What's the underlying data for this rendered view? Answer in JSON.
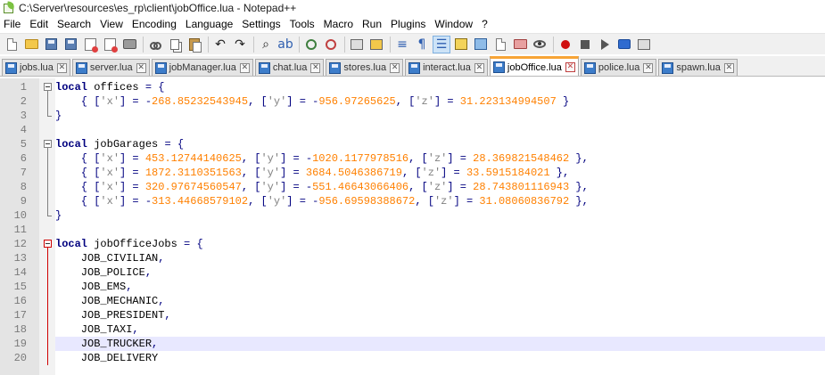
{
  "window": {
    "title": "C:\\Server\\resources\\es_rp\\client\\jobOffice.lua - Notepad++"
  },
  "menu": [
    "File",
    "Edit",
    "Search",
    "View",
    "Encoding",
    "Language",
    "Settings",
    "Tools",
    "Macro",
    "Run",
    "Plugins",
    "Window",
    "?"
  ],
  "toolbar": {
    "icons": [
      "new-file-icon",
      "open-file-icon",
      "save-icon",
      "save-all-icon",
      "close-icon",
      "close-all-icon",
      "print-icon",
      "cut-icon",
      "copy-icon",
      "paste-icon",
      "undo-icon",
      "redo-icon",
      "find-icon",
      "replace-icon",
      "zoom-in-icon",
      "zoom-out-icon",
      "sync-vertical-icon",
      "sync-horizontal-icon",
      "word-wrap-icon",
      "show-all-chars-icon",
      "indent-guide-icon",
      "user-language-icon",
      "doc-map-icon",
      "function-list-icon",
      "folder-workspace-icon",
      "monitoring-icon",
      "record-macro-icon",
      "stop-macro-icon",
      "play-macro-icon",
      "run-macro-multiple-icon",
      "save-macro-icon"
    ],
    "active_icon": "indent-guide-icon"
  },
  "tabs": [
    {
      "label": "jobs.lua",
      "active": false
    },
    {
      "label": "server.lua",
      "active": false
    },
    {
      "label": "jobManager.lua",
      "active": false
    },
    {
      "label": "chat.lua",
      "active": false
    },
    {
      "label": "stores.lua",
      "active": false
    },
    {
      "label": "interact.lua",
      "active": false
    },
    {
      "label": "jobOffice.lua",
      "active": true
    },
    {
      "label": "police.lua",
      "active": false
    },
    {
      "label": "spawn.lua",
      "active": false
    }
  ],
  "editor": {
    "current_line": 19,
    "lines": [
      {
        "n": "1",
        "fold": "open",
        "tokens": [
          [
            "kw",
            "local"
          ],
          [
            "id",
            " offices "
          ],
          [
            "op",
            "= {"
          ]
        ]
      },
      {
        "n": "2",
        "fold": "line",
        "tokens": [
          [
            "op",
            "    { ["
          ],
          [
            "str",
            "'x'"
          ],
          [
            "op",
            "] = -"
          ],
          [
            "num",
            "268.85232543945"
          ],
          [
            "op",
            ", ["
          ],
          [
            "str",
            "'y'"
          ],
          [
            "op",
            "] = -"
          ],
          [
            "num",
            "956.97265625"
          ],
          [
            "op",
            ", ["
          ],
          [
            "str",
            "'z'"
          ],
          [
            "op",
            "] = "
          ],
          [
            "num",
            "31.223134994507"
          ],
          [
            "op",
            " }"
          ]
        ]
      },
      {
        "n": "3",
        "fold": "end",
        "tokens": [
          [
            "op",
            "}"
          ]
        ]
      },
      {
        "n": "4",
        "fold": "none",
        "tokens": []
      },
      {
        "n": "5",
        "fold": "open",
        "tokens": [
          [
            "kw",
            "local"
          ],
          [
            "id",
            " jobGarages "
          ],
          [
            "op",
            "= {"
          ]
        ]
      },
      {
        "n": "6",
        "fold": "line",
        "tokens": [
          [
            "op",
            "    { ["
          ],
          [
            "str",
            "'x'"
          ],
          [
            "op",
            "] = "
          ],
          [
            "num",
            "453.12744140625"
          ],
          [
            "op",
            ", ["
          ],
          [
            "str",
            "'y'"
          ],
          [
            "op",
            "] = -"
          ],
          [
            "num",
            "1020.1177978516"
          ],
          [
            "op",
            ", ["
          ],
          [
            "str",
            "'z'"
          ],
          [
            "op",
            "] = "
          ],
          [
            "num",
            "28.369821548462"
          ],
          [
            "op",
            " },"
          ]
        ]
      },
      {
        "n": "7",
        "fold": "line",
        "tokens": [
          [
            "op",
            "    { ["
          ],
          [
            "str",
            "'x'"
          ],
          [
            "op",
            "] = "
          ],
          [
            "num",
            "1872.3110351563"
          ],
          [
            "op",
            ", ["
          ],
          [
            "str",
            "'y'"
          ],
          [
            "op",
            "] = "
          ],
          [
            "num",
            "3684.5046386719"
          ],
          [
            "op",
            ", ["
          ],
          [
            "str",
            "'z'"
          ],
          [
            "op",
            "] = "
          ],
          [
            "num",
            "33.5915184021"
          ],
          [
            "op",
            " },"
          ]
        ]
      },
      {
        "n": "8",
        "fold": "line",
        "tokens": [
          [
            "op",
            "    { ["
          ],
          [
            "str",
            "'x'"
          ],
          [
            "op",
            "] = "
          ],
          [
            "num",
            "320.97674560547"
          ],
          [
            "op",
            ", ["
          ],
          [
            "str",
            "'y'"
          ],
          [
            "op",
            "] = -"
          ],
          [
            "num",
            "551.46643066406"
          ],
          [
            "op",
            ", ["
          ],
          [
            "str",
            "'z'"
          ],
          [
            "op",
            "] = "
          ],
          [
            "num",
            "28.743801116943"
          ],
          [
            "op",
            " },"
          ]
        ]
      },
      {
        "n": "9",
        "fold": "line",
        "tokens": [
          [
            "op",
            "    { ["
          ],
          [
            "str",
            "'x'"
          ],
          [
            "op",
            "] = -"
          ],
          [
            "num",
            "313.44668579102"
          ],
          [
            "op",
            ", ["
          ],
          [
            "str",
            "'y'"
          ],
          [
            "op",
            "] = -"
          ],
          [
            "num",
            "956.69598388672"
          ],
          [
            "op",
            ", ["
          ],
          [
            "str",
            "'z'"
          ],
          [
            "op",
            "] = "
          ],
          [
            "num",
            "31.08060836792"
          ],
          [
            "op",
            " },"
          ]
        ]
      },
      {
        "n": "10",
        "fold": "end",
        "tokens": [
          [
            "op",
            "}"
          ]
        ]
      },
      {
        "n": "11",
        "fold": "none",
        "tokens": []
      },
      {
        "n": "12",
        "fold": "open-red",
        "tokens": [
          [
            "kw",
            "local"
          ],
          [
            "id",
            " jobOfficeJobs "
          ],
          [
            "op",
            "= {"
          ]
        ]
      },
      {
        "n": "13",
        "fold": "line-red",
        "tokens": [
          [
            "id",
            "    JOB_CIVILIAN"
          ],
          [
            "op",
            ","
          ]
        ]
      },
      {
        "n": "14",
        "fold": "line-red",
        "tokens": [
          [
            "id",
            "    JOB_POLICE"
          ],
          [
            "op",
            ","
          ]
        ]
      },
      {
        "n": "15",
        "fold": "line-red",
        "tokens": [
          [
            "id",
            "    JOB_EMS"
          ],
          [
            "op",
            ","
          ]
        ]
      },
      {
        "n": "16",
        "fold": "line-red",
        "tokens": [
          [
            "id",
            "    JOB_MECHANIC"
          ],
          [
            "op",
            ","
          ]
        ]
      },
      {
        "n": "17",
        "fold": "line-red",
        "tokens": [
          [
            "id",
            "    JOB_PRESIDENT"
          ],
          [
            "op",
            ","
          ]
        ]
      },
      {
        "n": "18",
        "fold": "line-red",
        "tokens": [
          [
            "id",
            "    JOB_TAXI"
          ],
          [
            "op",
            ","
          ]
        ]
      },
      {
        "n": "19",
        "fold": "line-red",
        "tokens": [
          [
            "id",
            "    JOB_TRUCKER"
          ],
          [
            "op",
            ","
          ]
        ]
      },
      {
        "n": "20",
        "fold": "line-red",
        "tokens": [
          [
            "id",
            "    JOB_DELIVERY"
          ]
        ]
      }
    ]
  },
  "colors": {
    "keyword": "#00007f",
    "number": "#ff8000",
    "string": "#808080",
    "active_tab_accent": "#f7a436",
    "current_line": "#e8e8ff",
    "fold_active": "#d00000"
  }
}
